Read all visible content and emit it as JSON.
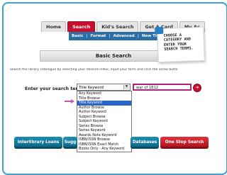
{
  "tabs": [
    {
      "label": "Home"
    },
    {
      "label": "Search",
      "active": true
    },
    {
      "label": "Kid's Search"
    },
    {
      "label": "Get A Card"
    },
    {
      "label": "My Ac"
    }
  ],
  "subnav": [
    "Basic",
    "|",
    "Format",
    "|",
    "Advanced",
    "|",
    "New Titles"
  ],
  "panel_title": "Basic Search",
  "help_text": "Search the library catalogue by selecting your desired index, input your term and click the arrow butto",
  "search_label": "Enter your search term:",
  "index_select": {
    "value": "Title Keyword",
    "arrow": "▼"
  },
  "search_field": {
    "value": "war of 1812"
  },
  "go_button": "➜",
  "index_options": [
    "Any Keyword",
    "Title Browse",
    "Title Keyword",
    "Author Browse",
    "Author Keyword",
    "Subject Browse",
    "Subject Keyword",
    "Series Browse",
    "Series Keyword",
    "Awards Note Keyword",
    "ISBN/ISSN Browse",
    "ISBN/ISSN Exact Match",
    "Books Only - Any Keyword"
  ],
  "selected_index": 2,
  "buttons": {
    "interlibrary": "Interlibrary Loans",
    "suggest": "Sugg",
    "databases": "Databases",
    "one_stop": "One Stop Search"
  },
  "callout_note": "CHOOSE A CATEGORY AND ENTER YOUR SEARCH TERMS.",
  "colors": {
    "accent": "#c8102e",
    "frame": "#3ea0d6",
    "highlight": "#2a64c5",
    "pointer": "#c05aa5"
  }
}
